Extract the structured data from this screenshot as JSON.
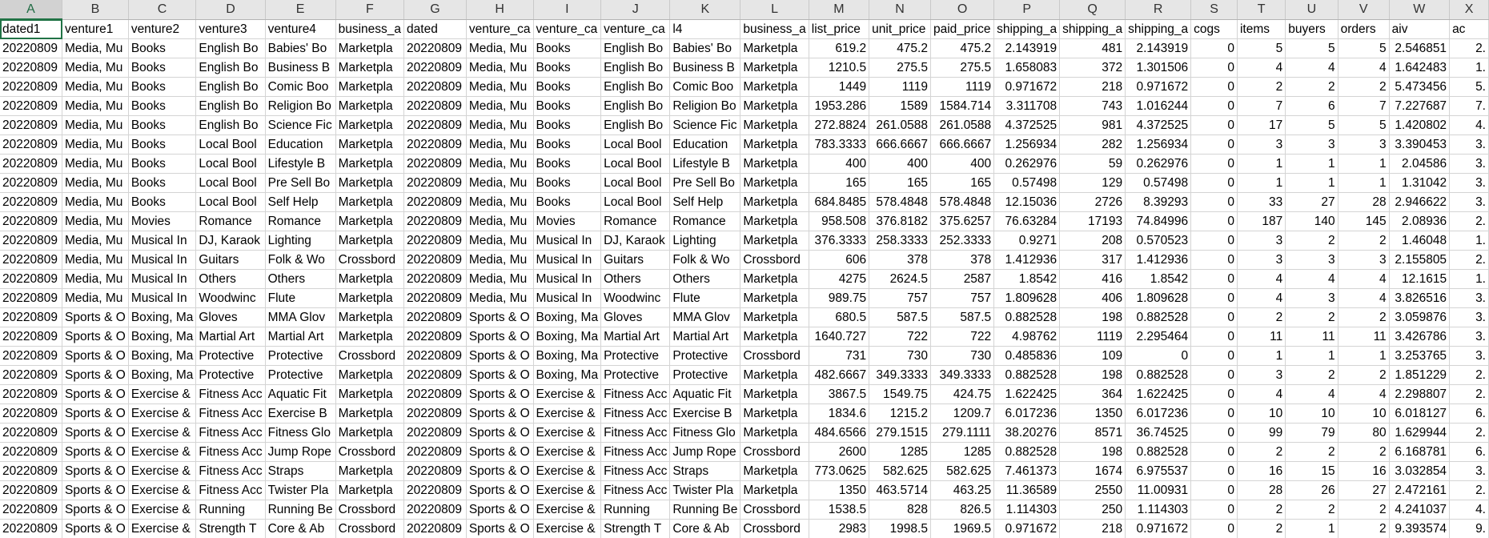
{
  "columns": [
    "A",
    "B",
    "C",
    "D",
    "E",
    "F",
    "G",
    "H",
    "I",
    "J",
    "K",
    "L",
    "M",
    "N",
    "O",
    "P",
    "Q",
    "R",
    "S",
    "T",
    "U",
    "V",
    "W",
    "X"
  ],
  "selected_cell": "A1",
  "header_row": [
    "dated1",
    "venture1",
    "venture2",
    "venture3",
    "venture4",
    "business_a",
    "dated",
    "venture_ca",
    "venture_ca",
    "venture_ca",
    "l4",
    "business_a",
    "list_price",
    "unit_price",
    "paid_price",
    "shipping_a",
    "shipping_a",
    "shipping_a",
    "cogs",
    "items",
    "buyers",
    "orders",
    "aiv",
    "ac"
  ],
  "rows": [
    [
      "20220809",
      "Media, Mu",
      "Books",
      "English Bo",
      "Babies' Bo",
      "Marketpla",
      "20220809",
      "Media, Mu",
      "Books",
      "English Bo",
      "Babies' Bo",
      "Marketpla",
      "619.2",
      "475.2",
      "475.2",
      "2.143919",
      "481",
      "2.143919",
      "0",
      "5",
      "5",
      "5",
      "2.546851",
      "2."
    ],
    [
      "20220809",
      "Media, Mu",
      "Books",
      "English Bo",
      "Business B",
      "Marketpla",
      "20220809",
      "Media, Mu",
      "Books",
      "English Bo",
      "Business B",
      "Marketpla",
      "1210.5",
      "275.5",
      "275.5",
      "1.658083",
      "372",
      "1.301506",
      "0",
      "4",
      "4",
      "4",
      "1.642483",
      "1."
    ],
    [
      "20220809",
      "Media, Mu",
      "Books",
      "English Bo",
      "Comic Boo",
      "Marketpla",
      "20220809",
      "Media, Mu",
      "Books",
      "English Bo",
      "Comic Boo",
      "Marketpla",
      "1449",
      "1119",
      "1119",
      "0.971672",
      "218",
      "0.971672",
      "0",
      "2",
      "2",
      "2",
      "5.473456",
      "5."
    ],
    [
      "20220809",
      "Media, Mu",
      "Books",
      "English Bo",
      "Religion Bo",
      "Marketpla",
      "20220809",
      "Media, Mu",
      "Books",
      "English Bo",
      "Religion Bo",
      "Marketpla",
      "1953.286",
      "1589",
      "1584.714",
      "3.311708",
      "743",
      "1.016244",
      "0",
      "7",
      "6",
      "7",
      "7.227687",
      "7."
    ],
    [
      "20220809",
      "Media, Mu",
      "Books",
      "English Bo",
      "Science Fic",
      "Marketpla",
      "20220809",
      "Media, Mu",
      "Books",
      "English Bo",
      "Science Fic",
      "Marketpla",
      "272.8824",
      "261.0588",
      "261.0588",
      "4.372525",
      "981",
      "4.372525",
      "0",
      "17",
      "5",
      "5",
      "1.420802",
      "4."
    ],
    [
      "20220809",
      "Media, Mu",
      "Books",
      "Local Bool",
      "Education",
      "Marketpla",
      "20220809",
      "Media, Mu",
      "Books",
      "Local Bool",
      "Education",
      "Marketpla",
      "783.3333",
      "666.6667",
      "666.6667",
      "1.256934",
      "282",
      "1.256934",
      "0",
      "3",
      "3",
      "3",
      "3.390453",
      "3."
    ],
    [
      "20220809",
      "Media, Mu",
      "Books",
      "Local Bool",
      "Lifestyle B",
      "Marketpla",
      "20220809",
      "Media, Mu",
      "Books",
      "Local Bool",
      "Lifestyle B",
      "Marketpla",
      "400",
      "400",
      "400",
      "0.262976",
      "59",
      "0.262976",
      "0",
      "1",
      "1",
      "1",
      "2.04586",
      "3."
    ],
    [
      "20220809",
      "Media, Mu",
      "Books",
      "Local Bool",
      "Pre Sell Bo",
      "Marketpla",
      "20220809",
      "Media, Mu",
      "Books",
      "Local Bool",
      "Pre Sell Bo",
      "Marketpla",
      "165",
      "165",
      "165",
      "0.57498",
      "129",
      "0.57498",
      "0",
      "1",
      "1",
      "1",
      "1.31042",
      "3."
    ],
    [
      "20220809",
      "Media, Mu",
      "Books",
      "Local Bool",
      "Self Help",
      "Marketpla",
      "20220809",
      "Media, Mu",
      "Books",
      "Local Bool",
      "Self Help",
      "Marketpla",
      "684.8485",
      "578.4848",
      "578.4848",
      "12.15036",
      "2726",
      "8.39293",
      "0",
      "33",
      "27",
      "28",
      "2.946622",
      "3."
    ],
    [
      "20220809",
      "Media, Mu",
      "Movies",
      "Romance",
      "Romance",
      "Marketpla",
      "20220809",
      "Media, Mu",
      "Movies",
      "Romance",
      "Romance",
      "Marketpla",
      "958.508",
      "376.8182",
      "375.6257",
      "76.63284",
      "17193",
      "74.84996",
      "0",
      "187",
      "140",
      "145",
      "2.08936",
      "2."
    ],
    [
      "20220809",
      "Media, Mu",
      "Musical In",
      "DJ, Karaok",
      "Lighting",
      "Marketpla",
      "20220809",
      "Media, Mu",
      "Musical In",
      "DJ, Karaok",
      "Lighting",
      "Marketpla",
      "376.3333",
      "258.3333",
      "252.3333",
      "0.9271",
      "208",
      "0.570523",
      "0",
      "3",
      "2",
      "2",
      "1.46048",
      "1."
    ],
    [
      "20220809",
      "Media, Mu",
      "Musical In",
      "Guitars",
      "Folk & Wo",
      "Crossbord",
      "20220809",
      "Media, Mu",
      "Musical In",
      "Guitars",
      "Folk & Wo",
      "Crossbord",
      "606",
      "378",
      "378",
      "1.412936",
      "317",
      "1.412936",
      "0",
      "3",
      "3",
      "3",
      "2.155805",
      "2."
    ],
    [
      "20220809",
      "Media, Mu",
      "Musical In",
      "Others",
      "Others",
      "Marketpla",
      "20220809",
      "Media, Mu",
      "Musical In",
      "Others",
      "Others",
      "Marketpla",
      "4275",
      "2624.5",
      "2587",
      "1.8542",
      "416",
      "1.8542",
      "0",
      "4",
      "4",
      "4",
      "12.1615",
      "1."
    ],
    [
      "20220809",
      "Media, Mu",
      "Musical In",
      "Woodwinc",
      "Flute",
      "Marketpla",
      "20220809",
      "Media, Mu",
      "Musical In",
      "Woodwinc",
      "Flute",
      "Marketpla",
      "989.75",
      "757",
      "757",
      "1.809628",
      "406",
      "1.809628",
      "0",
      "4",
      "3",
      "4",
      "3.826516",
      "3."
    ],
    [
      "20220809",
      "Sports & O",
      "Boxing, Ma",
      "Gloves",
      "MMA Glov",
      "Marketpla",
      "20220809",
      "Sports & O",
      "Boxing, Ma",
      "Gloves",
      "MMA Glov",
      "Marketpla",
      "680.5",
      "587.5",
      "587.5",
      "0.882528",
      "198",
      "0.882528",
      "0",
      "2",
      "2",
      "2",
      "3.059876",
      "3."
    ],
    [
      "20220809",
      "Sports & O",
      "Boxing, Ma",
      "Martial Art",
      "Martial Art",
      "Marketpla",
      "20220809",
      "Sports & O",
      "Boxing, Ma",
      "Martial Art",
      "Martial Art",
      "Marketpla",
      "1640.727",
      "722",
      "722",
      "4.98762",
      "1119",
      "2.295464",
      "0",
      "11",
      "11",
      "11",
      "3.426786",
      "3."
    ],
    [
      "20220809",
      "Sports & O",
      "Boxing, Ma",
      "Protective",
      "Protective",
      "Crossbord",
      "20220809",
      "Sports & O",
      "Boxing, Ma",
      "Protective",
      "Protective",
      "Crossbord",
      "731",
      "730",
      "730",
      "0.485836",
      "109",
      "0",
      "0",
      "1",
      "1",
      "1",
      "3.253765",
      "3."
    ],
    [
      "20220809",
      "Sports & O",
      "Boxing, Ma",
      "Protective",
      "Protective",
      "Marketpla",
      "20220809",
      "Sports & O",
      "Boxing, Ma",
      "Protective",
      "Protective",
      "Marketpla",
      "482.6667",
      "349.3333",
      "349.3333",
      "0.882528",
      "198",
      "0.882528",
      "0",
      "3",
      "2",
      "2",
      "1.851229",
      "2."
    ],
    [
      "20220809",
      "Sports & O",
      "Exercise &",
      "Fitness Acc",
      "Aquatic Fit",
      "Marketpla",
      "20220809",
      "Sports & O",
      "Exercise &",
      "Fitness Acc",
      "Aquatic Fit",
      "Marketpla",
      "3867.5",
      "1549.75",
      "424.75",
      "1.622425",
      "364",
      "1.622425",
      "0",
      "4",
      "4",
      "4",
      "2.298807",
      "2."
    ],
    [
      "20220809",
      "Sports & O",
      "Exercise &",
      "Fitness Acc",
      "Exercise B",
      "Marketpla",
      "20220809",
      "Sports & O",
      "Exercise &",
      "Fitness Acc",
      "Exercise B",
      "Marketpla",
      "1834.6",
      "1215.2",
      "1209.7",
      "6.017236",
      "1350",
      "6.017236",
      "0",
      "10",
      "10",
      "10",
      "6.018127",
      "6."
    ],
    [
      "20220809",
      "Sports & O",
      "Exercise &",
      "Fitness Acc",
      "Fitness Glo",
      "Marketpla",
      "20220809",
      "Sports & O",
      "Exercise &",
      "Fitness Acc",
      "Fitness Glo",
      "Marketpla",
      "484.6566",
      "279.1515",
      "279.1111",
      "38.20276",
      "8571",
      "36.74525",
      "0",
      "99",
      "79",
      "80",
      "1.629944",
      "2."
    ],
    [
      "20220809",
      "Sports & O",
      "Exercise &",
      "Fitness Acc",
      "Jump Rope",
      "Crossbord",
      "20220809",
      "Sports & O",
      "Exercise &",
      "Fitness Acc",
      "Jump Rope",
      "Crossbord",
      "2600",
      "1285",
      "1285",
      "0.882528",
      "198",
      "0.882528",
      "0",
      "2",
      "2",
      "2",
      "6.168781",
      "6."
    ],
    [
      "20220809",
      "Sports & O",
      "Exercise &",
      "Fitness Acc",
      "Straps",
      "Marketpla",
      "20220809",
      "Sports & O",
      "Exercise &",
      "Fitness Acc",
      "Straps",
      "Marketpla",
      "773.0625",
      "582.625",
      "582.625",
      "7.461373",
      "1674",
      "6.975537",
      "0",
      "16",
      "15",
      "16",
      "3.032854",
      "3."
    ],
    [
      "20220809",
      "Sports & O",
      "Exercise &",
      "Fitness Acc",
      "Twister Pla",
      "Marketpla",
      "20220809",
      "Sports & O",
      "Exercise &",
      "Fitness Acc",
      "Twister Pla",
      "Marketpla",
      "1350",
      "463.5714",
      "463.25",
      "11.36589",
      "2550",
      "11.00931",
      "0",
      "28",
      "26",
      "27",
      "2.472161",
      "2."
    ],
    [
      "20220809",
      "Sports & O",
      "Exercise &",
      "Running",
      "Running Be",
      "Crossbord",
      "20220809",
      "Sports & O",
      "Exercise &",
      "Running",
      "Running Be",
      "Crossbord",
      "1538.5",
      "828",
      "826.5",
      "1.114303",
      "250",
      "1.114303",
      "0",
      "2",
      "2",
      "2",
      "4.241037",
      "4."
    ],
    [
      "20220809",
      "Sports & O",
      "Exercise &",
      "Strength T",
      "Core & Ab",
      "Crossbord",
      "20220809",
      "Sports & O",
      "Exercise &",
      "Strength T",
      "Core & Ab",
      "Crossbord",
      "2983",
      "1998.5",
      "1969.5",
      "0.971672",
      "218",
      "0.971672",
      "0",
      "2",
      "1",
      "2",
      "9.393574",
      "9."
    ]
  ]
}
